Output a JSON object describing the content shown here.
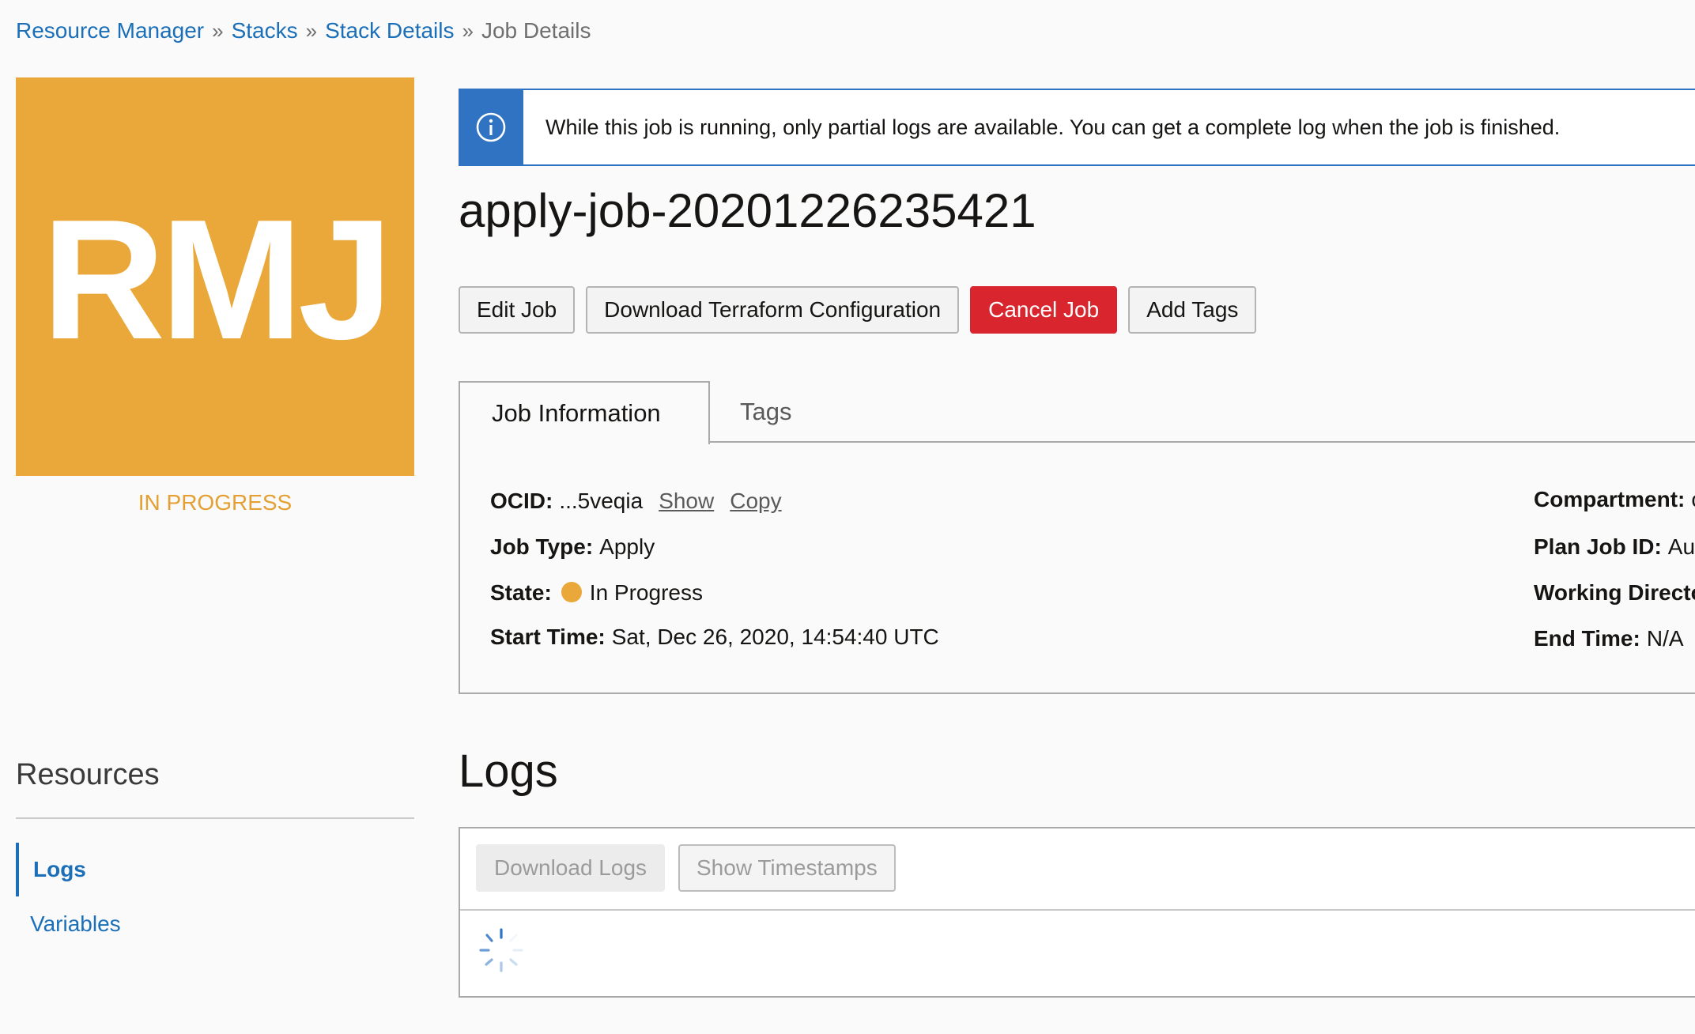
{
  "breadcrumb": {
    "items": [
      "Resource Manager",
      "Stacks",
      "Stack Details"
    ],
    "separator": "»",
    "current": "Job Details"
  },
  "badge": {
    "initials": "RMJ",
    "status": "IN PROGRESS",
    "color": "#eaa83a"
  },
  "banner": {
    "icon": "info-icon",
    "message": "While this job is running, only partial logs are available. You can get a complete log when the job is finished."
  },
  "job": {
    "title": "apply-job-20201226235421"
  },
  "actions": {
    "edit": "Edit Job",
    "download": "Download Terraform Configuration",
    "cancel": "Cancel Job",
    "add_tags": "Add Tags"
  },
  "tabs": {
    "active": "Job Information",
    "other": "Tags"
  },
  "details": {
    "ocid_label": "OCID:",
    "ocid_value": "...5veqia",
    "show_link": "Show",
    "copy_link": "Copy",
    "type_label": "Job Type:",
    "type_value": "Apply",
    "state_label": "State:",
    "state_value": "In Progress",
    "start_label": "Start Time:",
    "start_value": "Sat, Dec 26, 2020, 14:54:40 UTC",
    "compartment_label": "Compartment:",
    "compartment_value": "c",
    "planjob_label": "Plan Job ID:",
    "planjob_value": "Au",
    "workdir_label": "Working Directo",
    "endtime_label": "End Time:",
    "endtime_value": "N/A"
  },
  "resources": {
    "title": "Resources",
    "items": [
      "Logs",
      "Variables"
    ]
  },
  "logs": {
    "title": "Logs",
    "download_label": "Download Logs",
    "timestamps_label": "Show Timestamps"
  },
  "colors": {
    "link": "#1a6fb8",
    "danger": "#d9262e",
    "info": "#2f73c2",
    "in_progress": "#eaa83a"
  }
}
